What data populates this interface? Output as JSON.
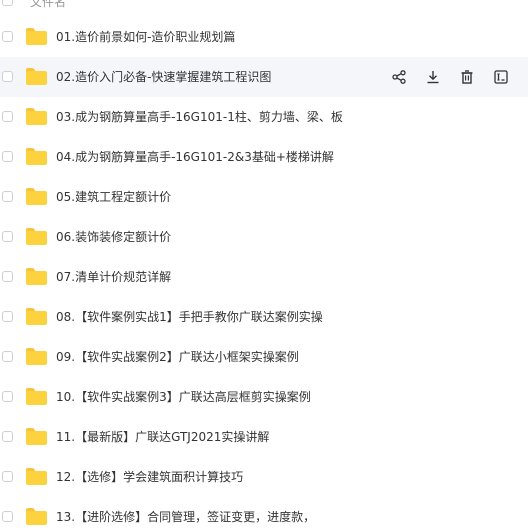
{
  "header": {
    "column_name": "文件名"
  },
  "files": [
    {
      "name": "01.造价前景如何-造价职业规划篇"
    },
    {
      "name": "02.造价入门必备-快速掌握建筑工程识图"
    },
    {
      "name": "03.成为钢筋算量高手-16G101-1柱、剪力墙、梁、板"
    },
    {
      "name": "04.成为钢筋算量高手-16G101-2&3基础+楼梯讲解"
    },
    {
      "name": "05.建筑工程定额计价"
    },
    {
      "name": "06.装饰装修定额计价"
    },
    {
      "name": "07.清单计价规范详解"
    },
    {
      "name": "08.【软件案例实战1】手把手教你广联达案例实操"
    },
    {
      "name": "09.【软件实战案例2】广联达小框架实操案例"
    },
    {
      "name": "10.【软件实战案例3】广联达高层框剪实操案例"
    },
    {
      "name": "11.【最新版】广联达GTJ2021实操讲解"
    },
    {
      "name": "12.【选修】学会建筑面积计算技巧"
    },
    {
      "name": "13.【进阶选修】合同管理，签证变更，进度款，"
    }
  ],
  "hovered_row_index": 1,
  "row_actions": [
    {
      "icon": "share-icon"
    },
    {
      "icon": "download-icon"
    },
    {
      "icon": "delete-icon"
    },
    {
      "icon": "rename-icon"
    }
  ],
  "colors": {
    "folder": "#fcd33f",
    "hover_background": "#f5f6fa",
    "text": "#333333"
  }
}
